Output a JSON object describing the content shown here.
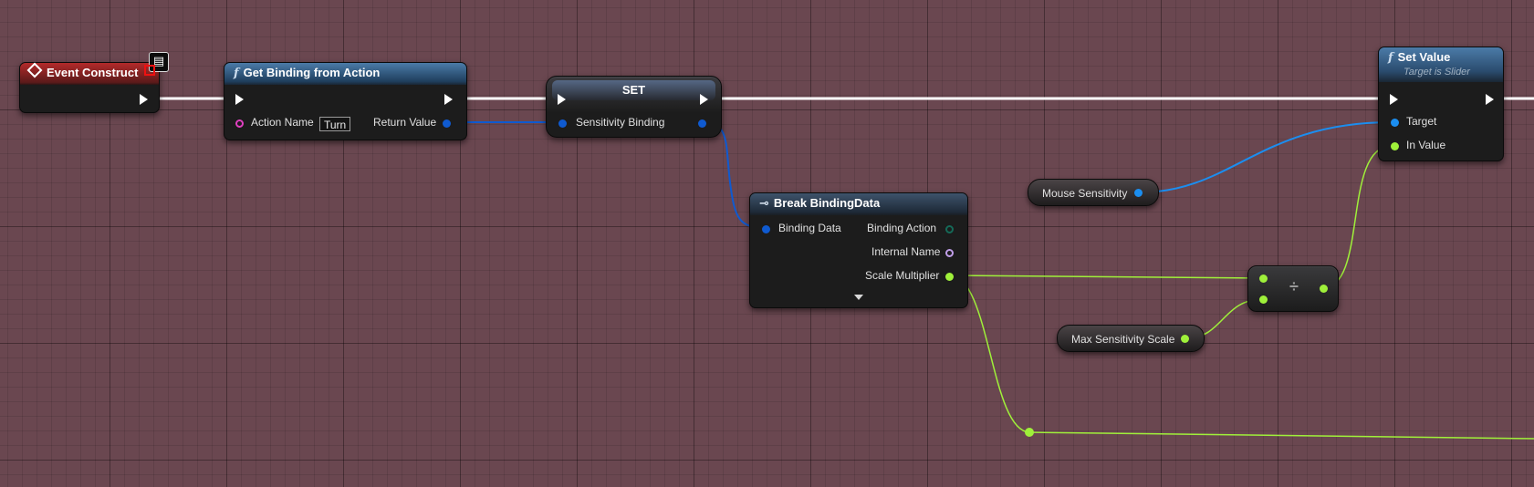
{
  "graph": {
    "event_construct": {
      "title": "Event Construct"
    },
    "get_binding": {
      "title": "Get Binding from Action",
      "function_icon": "f",
      "action_name_label": "Action Name",
      "action_name_value": "Turn",
      "return_value_label": "Return Value"
    },
    "set_node": {
      "title": "SET",
      "pin_label": "Sensitivity Binding"
    },
    "break_binding": {
      "title": "Break BindingData",
      "binding_data_label": "Binding Data",
      "binding_action_label": "Binding Action",
      "internal_name_label": "Internal Name",
      "scale_multiplier_label": "Scale Multiplier"
    },
    "mouse_sensitivity": {
      "label": "Mouse Sensitivity"
    },
    "max_sensitivity_scale": {
      "label": "Max Sensitivity Scale"
    },
    "divide": {
      "symbol": "÷"
    },
    "set_value": {
      "title": "Set Value",
      "function_icon": "f",
      "subtitle": "Target is Slider",
      "target_label": "Target",
      "in_value_label": "In Value"
    }
  },
  "colors": {
    "exec_wire": "#ffffff",
    "object_wire": "#1b8ef0",
    "struct_wire": "#0f5ad0",
    "float_wire": "#9ff03a",
    "background": "#6a4750"
  },
  "icons": [
    "latent-monitor-icon",
    "function-icon",
    "break-struct-icon",
    "expand-arrow-icon"
  ]
}
